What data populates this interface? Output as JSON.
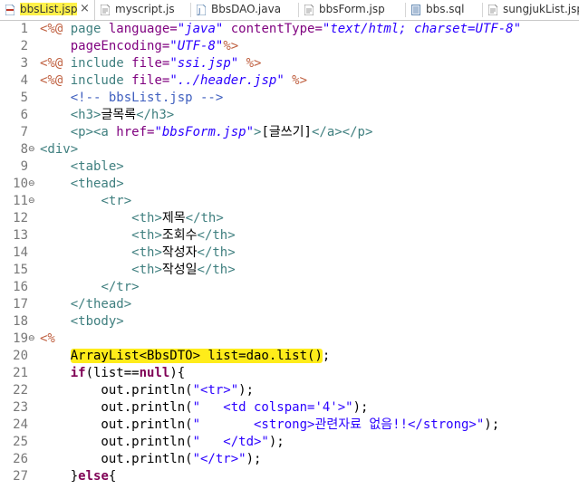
{
  "tabs": [
    {
      "label": "bbsList.jsp",
      "active": true,
      "icon": "jsp-file-icon"
    },
    {
      "label": "myscript.js",
      "active": false,
      "icon": "js-file-icon"
    },
    {
      "label": "BbsDAO.java",
      "active": false,
      "icon": "java-file-icon"
    },
    {
      "label": "bbsForm.jsp",
      "active": false,
      "icon": "jsp-file-icon"
    },
    {
      "label": "bbs.sql",
      "active": false,
      "icon": "sql-file-icon"
    },
    {
      "label": "sungjukList.jsp",
      "active": false,
      "icon": "jsp-file-icon"
    }
  ],
  "close_glyph": "×",
  "colors": {
    "directive": "#bf5f3f",
    "keyword": "#7f0055",
    "tag": "#3f7f7f",
    "attribute": "#7f007f",
    "string": "#2a00ff",
    "comment": "#3f5fbf",
    "highlight": "#ffec1a",
    "tab_highlight": "#fff14a"
  },
  "editor": {
    "lines": [
      {
        "n": "1",
        "fold": "",
        "t": [
          "<%@ ",
          "page ",
          "language=",
          "\"java\"",
          " contentType=",
          "\"text/html; charset=UTF-8\""
        ]
      },
      {
        "n": "2",
        "fold": "",
        "t": [
          "    pageEncoding=",
          "\"UTF-8\"",
          "%>"
        ]
      },
      {
        "n": "3",
        "fold": "",
        "t": [
          "<%@ ",
          "include ",
          "file=",
          "\"ssi.jsp\"",
          " %>"
        ]
      },
      {
        "n": "4",
        "fold": "",
        "t": [
          "<%@ ",
          "include ",
          "file=",
          "\"../header.jsp\"",
          " %>"
        ]
      },
      {
        "n": "5",
        "fold": "",
        "t": [
          "    ",
          "<!-- bbsList.jsp -->"
        ]
      },
      {
        "n": "6",
        "fold": "",
        "t": [
          "    ",
          "<h3>",
          "글목록",
          "</h3>"
        ]
      },
      {
        "n": "7",
        "fold": "",
        "t": [
          "    ",
          "<p><a ",
          "href=",
          "\"bbsForm.jsp\"",
          ">",
          "[글쓰기]",
          "</a></p>"
        ]
      },
      {
        "n": "8",
        "fold": "⊖",
        "t": [
          "<div>"
        ]
      },
      {
        "n": "9",
        "fold": "",
        "t": [
          "    ",
          "<table>"
        ]
      },
      {
        "n": "10",
        "fold": "⊖",
        "t": [
          "    ",
          "<thead>"
        ]
      },
      {
        "n": "11",
        "fold": "⊖",
        "t": [
          "        ",
          "<tr>"
        ]
      },
      {
        "n": "12",
        "fold": "",
        "t": [
          "            ",
          "<th>",
          "제목",
          "</th>"
        ]
      },
      {
        "n": "13",
        "fold": "",
        "t": [
          "            ",
          "<th>",
          "조회수",
          "</th>"
        ]
      },
      {
        "n": "14",
        "fold": "",
        "t": [
          "            ",
          "<th>",
          "작성자",
          "</th>"
        ]
      },
      {
        "n": "15",
        "fold": "",
        "t": [
          "            ",
          "<th>",
          "작성일",
          "</th>"
        ]
      },
      {
        "n": "16",
        "fold": "",
        "t": [
          "        ",
          "</tr>"
        ]
      },
      {
        "n": "17",
        "fold": "",
        "t": [
          "    ",
          "</thead>"
        ]
      },
      {
        "n": "18",
        "fold": "",
        "t": [
          "    ",
          "<tbody>"
        ]
      },
      {
        "n": "19",
        "fold": "⊖",
        "t": [
          "<%"
        ]
      },
      {
        "n": "20",
        "fold": "",
        "t": [
          "    ",
          "ArrayList<BbsDTO> list=dao.list()",
          ";"
        ]
      },
      {
        "n": "21",
        "fold": "",
        "t": [
          "    ",
          "if",
          "(list==",
          "null",
          "){"
        ]
      },
      {
        "n": "22",
        "fold": "",
        "t": [
          "        out.println(",
          "\"<tr>\"",
          ");"
        ]
      },
      {
        "n": "23",
        "fold": "",
        "t": [
          "        out.println(",
          "\"   <td colspan='4'>\"",
          ");"
        ]
      },
      {
        "n": "24",
        "fold": "",
        "t": [
          "        out.println(",
          "\"       <strong>관련자료 없음!!</strong>\"",
          ");"
        ]
      },
      {
        "n": "25",
        "fold": "",
        "t": [
          "        out.println(",
          "\"   </td>\"",
          ");"
        ]
      },
      {
        "n": "26",
        "fold": "",
        "t": [
          "        out.println(",
          "\"</tr>\"",
          ");"
        ]
      },
      {
        "n": "27",
        "fold": "",
        "t": [
          "    }",
          "else",
          "{"
        ]
      }
    ]
  }
}
